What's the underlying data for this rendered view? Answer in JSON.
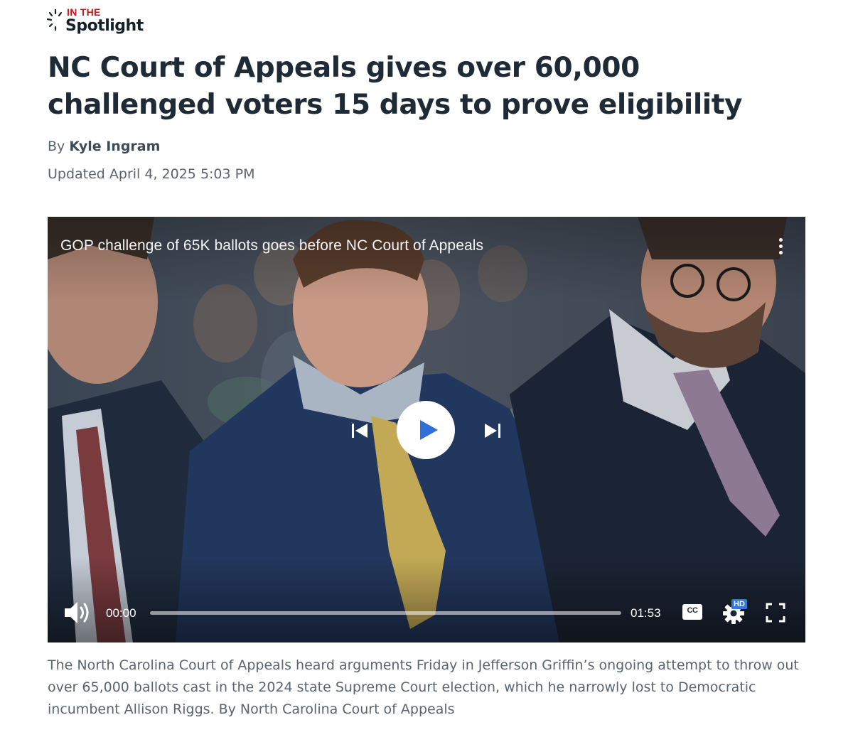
{
  "brand": {
    "line1": "IN THE",
    "line2": "Spotlight"
  },
  "article": {
    "headline": "NC Court of Appeals gives over 60,000 challenged voters 15 days to prove eligibility",
    "byline_prefix": "By",
    "author": "Kyle Ingram",
    "updated": "Updated April 4, 2025 5:03 PM"
  },
  "video": {
    "title": "GOP challenge of 65K ballots goes before NC Court of Appeals",
    "current_time": "00:00",
    "duration": "01:53",
    "progress": 0,
    "cc_label": "CC",
    "hd_label": "HD",
    "icons": [
      "more-icon",
      "skip-previous-icon",
      "play-icon",
      "skip-next-icon",
      "volume-icon",
      "captions-icon",
      "settings-icon",
      "fullscreen-icon"
    ]
  },
  "caption": "The North Carolina Court of Appeals heard arguments Friday in Jefferson Griffin’s ongoing attempt to throw out over 65,000 ballots cast in the 2024 state Supreme Court election, which he narrowly lost to Democratic incumbent Allison Riggs. By North Carolina Court of Appeals",
  "colors": {
    "brand_red": "#d0121b",
    "play_blue": "#2f6fdc",
    "hd_blue": "#2f78e6",
    "text": "#1e2a35",
    "muted": "#5a6470"
  }
}
